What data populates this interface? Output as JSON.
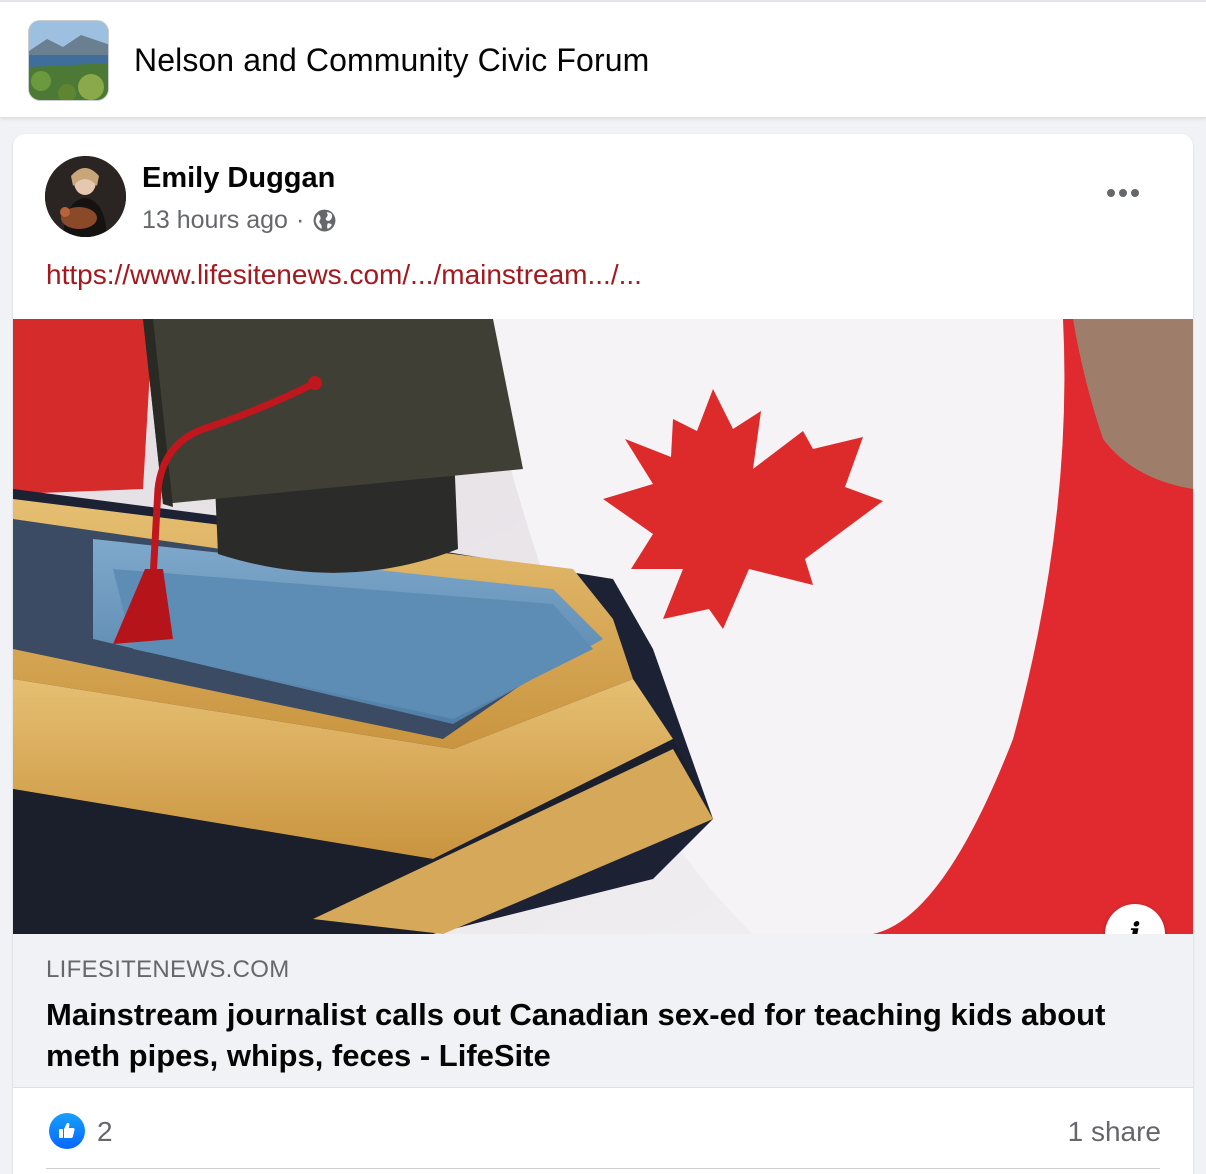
{
  "group": {
    "name": "Nelson and Community Civic Forum",
    "avatar_icon": "group-landscape-photo"
  },
  "post": {
    "author": "Emily Duggan",
    "timestamp": "13 hours ago",
    "separator": "·",
    "privacy_icon": "globe-icon",
    "more_icon": "more-options-icon",
    "link_text": "https://www.lifesitenews.com/.../mainstream.../...",
    "link_color": "#a3191e"
  },
  "link_preview": {
    "domain": "LIFESITENEWS.COM",
    "title": "Mainstream journalist calls out Canadian sex-ed for teaching kids about meth pipes, whips, feces - LifeSite",
    "info_label": "i",
    "image_icon": "canadian-flag-graduation-cap-books-photo"
  },
  "reactions": {
    "like_icon": "like-thumb-icon",
    "like_count": "2",
    "share_text": "1 share",
    "like_color": "#0866ff"
  }
}
